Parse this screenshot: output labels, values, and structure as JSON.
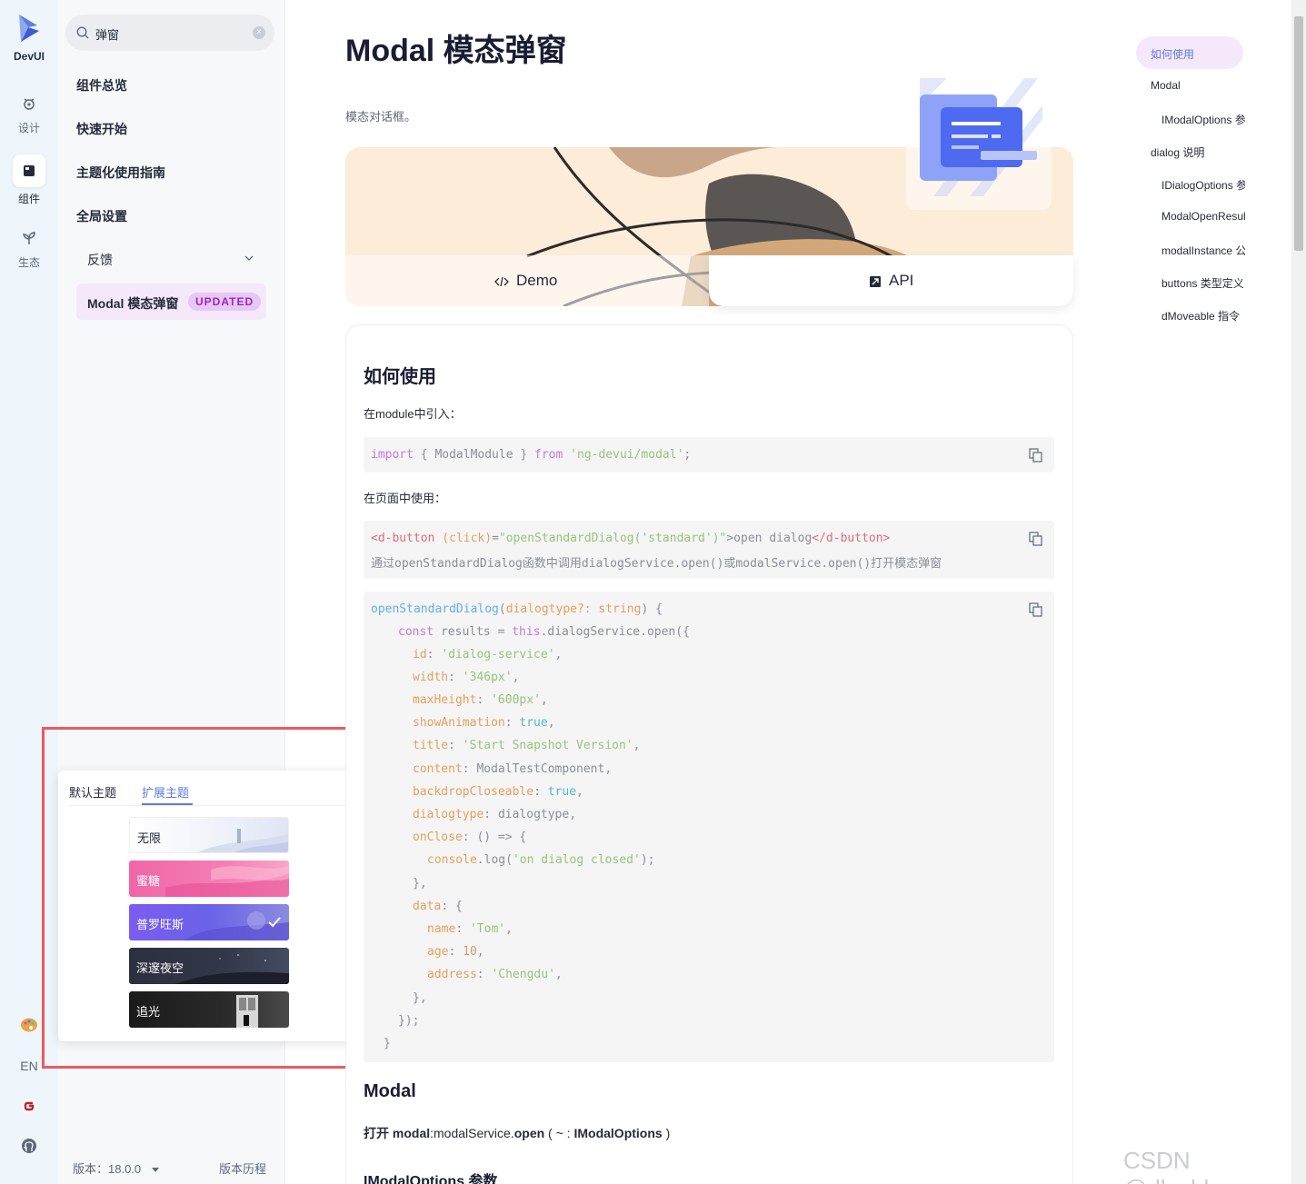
{
  "brand": {
    "name": "DevUI"
  },
  "rail": {
    "items": [
      {
        "label": "设计",
        "icon": "design-icon"
      },
      {
        "label": "组件",
        "icon": "component-icon"
      },
      {
        "label": "生态",
        "icon": "ecosystem-icon"
      }
    ],
    "lang": "EN"
  },
  "sidenav": {
    "search_value": "弹窗",
    "items": [
      "组件总览",
      "快速开始",
      "主题化使用指南",
      "全局设置"
    ],
    "group": "反馈",
    "active_item": "Modal 模态弹窗",
    "active_badge": "UPDATED",
    "version": "版本：18.0.0",
    "history": "版本历程"
  },
  "theme_popup": {
    "tabs": [
      "默认主题",
      "扩展主题"
    ],
    "themes": [
      {
        "name": "无限",
        "selected": false
      },
      {
        "name": "蜜糖",
        "selected": false
      },
      {
        "name": "普罗旺斯",
        "selected": true
      },
      {
        "name": "深邃夜空",
        "selected": false
      },
      {
        "name": "追光",
        "selected": false
      }
    ]
  },
  "page": {
    "title": "Modal 模态弹窗",
    "description": "模态对话框。",
    "tabs": {
      "demo": "Demo",
      "api": "API"
    }
  },
  "content": {
    "h_usage": "如何使用",
    "p_import": "在module中引入：",
    "code_import": [
      "import",
      " { ModalModule } ",
      "from",
      " 'ng-devui/modal'",
      ";"
    ],
    "p_page": "在页面中使用：",
    "code_html_1": [
      "<d-button",
      " (click)",
      "=",
      "\"openStandardDialog('standard')\"",
      ">open dialog",
      "</d-button>"
    ],
    "code_html_2": "通过openStandardDialog函数中调用dialogService.open()或modalService.open()打开模态弹窗",
    "code_ts": {
      "l1_fn": "openStandardDialog",
      "l1_param": "dialogtype?: string",
      "l2": [
        "const",
        " results = ",
        "this",
        ".dialogService.open({"
      ],
      "props": [
        {
          "k": "id",
          "v": "'dialog-service'",
          "t": "str"
        },
        {
          "k": "width",
          "v": "'346px'",
          "t": "str"
        },
        {
          "k": "maxHeight",
          "v": "'600px'",
          "t": "str"
        },
        {
          "k": "showAnimation",
          "v": "true",
          "t": "bool"
        },
        {
          "k": "title",
          "v": "'Start Snapshot Version'",
          "t": "str"
        },
        {
          "k": "content",
          "v": "ModalTestComponent",
          "t": "plain"
        },
        {
          "k": "backdropCloseable",
          "v": "true",
          "t": "bool"
        },
        {
          "k": "dialogtype",
          "v": "dialogtype",
          "t": "plain"
        }
      ],
      "onclose": "onClose",
      "onclose_rest": ": () => {",
      "console": "console",
      "console_rest": ".log(",
      "console_str": "'on dialog closed'",
      "console_end": ");",
      "close_brace": "},",
      "data_key": "data",
      "data_open": ": {",
      "data_props": [
        {
          "k": "name",
          "v": "'Tom'",
          "t": "str"
        },
        {
          "k": "age",
          "v": "10",
          "t": "num"
        },
        {
          "k": "address",
          "v": "'Chengdu'",
          "t": "str"
        }
      ],
      "end1": "},",
      "end2": "});",
      "end3": "}"
    },
    "h_modal": "Modal",
    "p_open_bold": "打开 modal",
    "p_open_rest": ":modalService.",
    "p_open_fn": "open",
    "p_open_args": " ( ~ : ",
    "p_open_type": "IModalOptions",
    "p_open_end": " )",
    "h_options": "IModalOptions 参数"
  },
  "toc": {
    "active": "如何使用",
    "items": [
      {
        "label": "Modal",
        "level": 1
      },
      {
        "label": "IModalOptions 参数",
        "level": 2
      },
      {
        "label": "dialog 说明",
        "level": 1
      },
      {
        "label": "IDialogOptions 参数",
        "level": 2
      },
      {
        "label": "ModalOpenResult",
        "level": 2
      },
      {
        "label": "modalInstance 公共方法",
        "level": 2
      },
      {
        "label": "buttons 类型定义",
        "level": 2
      },
      {
        "label": "dMoveable 指令",
        "level": 2
      }
    ]
  },
  "watermark": "CSDN @dly_blog",
  "colors": {
    "accent": "#5e7ce0",
    "badge": "#9f22c4",
    "highlight": "#ec5a5e"
  }
}
